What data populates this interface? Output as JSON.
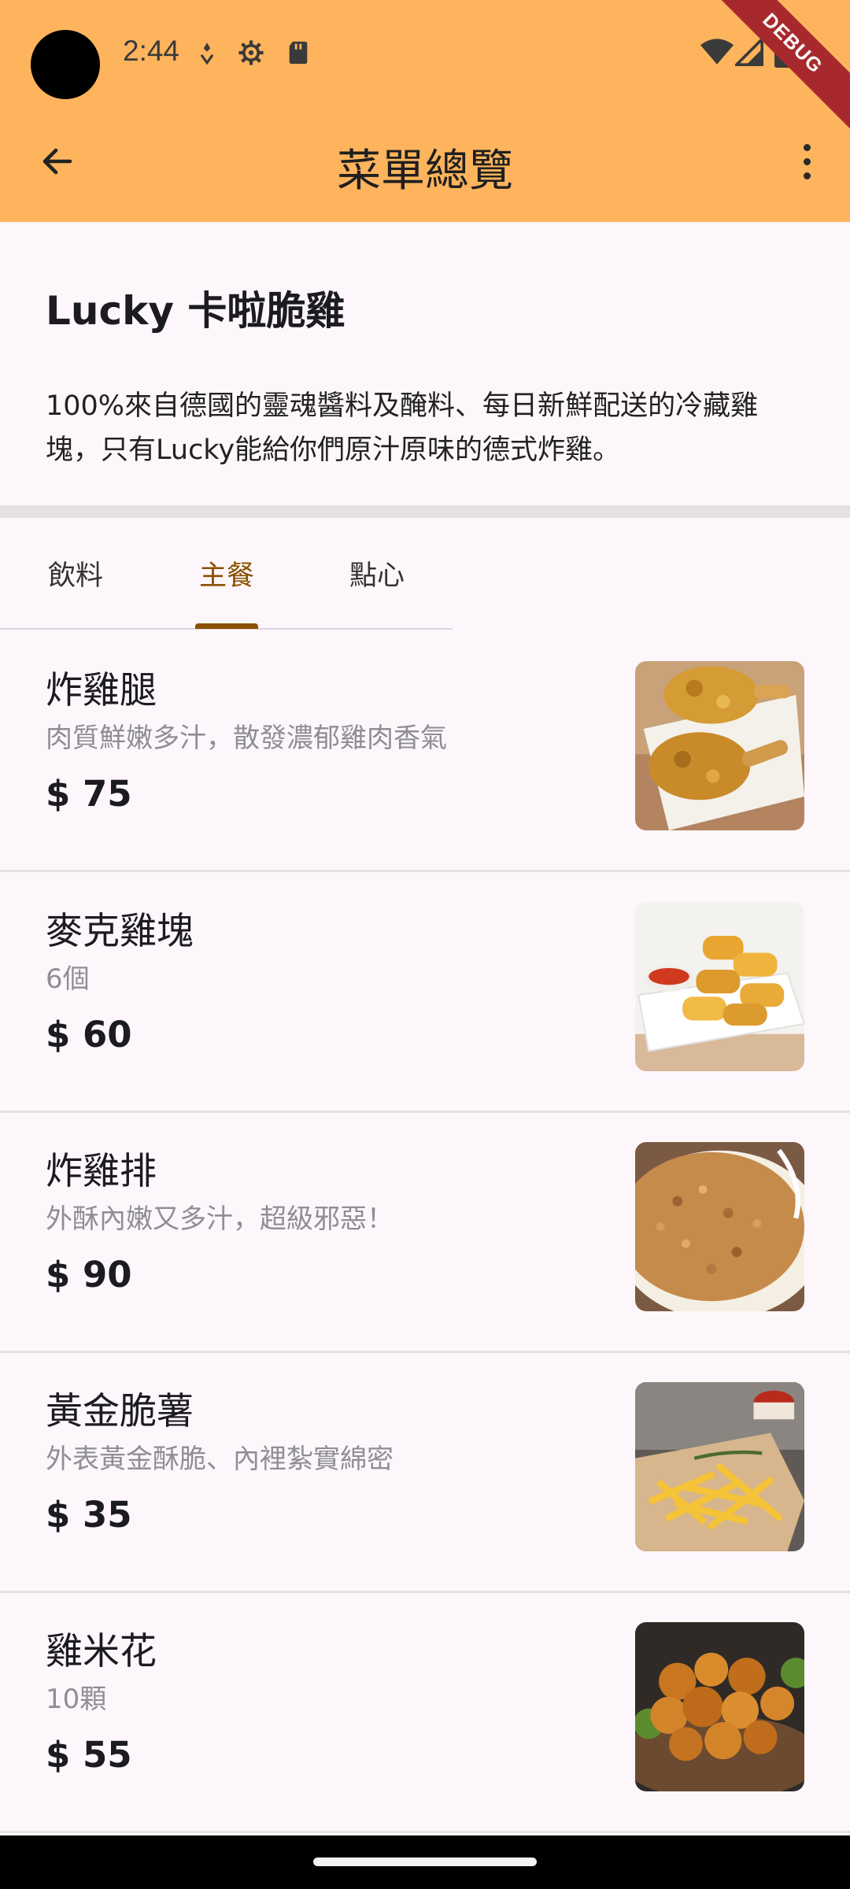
{
  "status_bar": {
    "time": "2:44"
  },
  "debug_badge": "DEBUG",
  "app_bar": {
    "title": "菜單總覽"
  },
  "restaurant": {
    "name": "Lucky 卡啦脆雞",
    "description": "100%來自德國的靈魂醬料及醃料、每日新鮮配送的冷藏雞塊，只有Lucky能給你們原汁原味的德式炸雞。"
  },
  "tabs": [
    {
      "label": "飲料",
      "active": false
    },
    {
      "label": "主餐",
      "active": true
    },
    {
      "label": "點心",
      "active": false
    }
  ],
  "menu_items": [
    {
      "name": "炸雞腿",
      "description": "肉質鮮嫩多汁，散發濃郁雞肉香氣",
      "price": "$ 75",
      "image": "fried-drumsticks"
    },
    {
      "name": "麥克雞塊",
      "description": "6個",
      "price": "$ 60",
      "image": "chicken-nuggets"
    },
    {
      "name": "炸雞排",
      "description": "外酥內嫩又多汁，超級邪惡！",
      "price": "$ 90",
      "image": "fried-chicken-cutlet"
    },
    {
      "name": "黃金脆薯",
      "description": "外表黃金酥脆、內裡紮實綿密",
      "price": "$ 35",
      "image": "french-fries"
    },
    {
      "name": "雞米花",
      "description": "10顆",
      "price": "$ 55",
      "image": "popcorn-chicken"
    }
  ],
  "colors": {
    "app_bar": "#fdb45d",
    "accent": "#8b5000",
    "background": "#fdf7fb"
  }
}
